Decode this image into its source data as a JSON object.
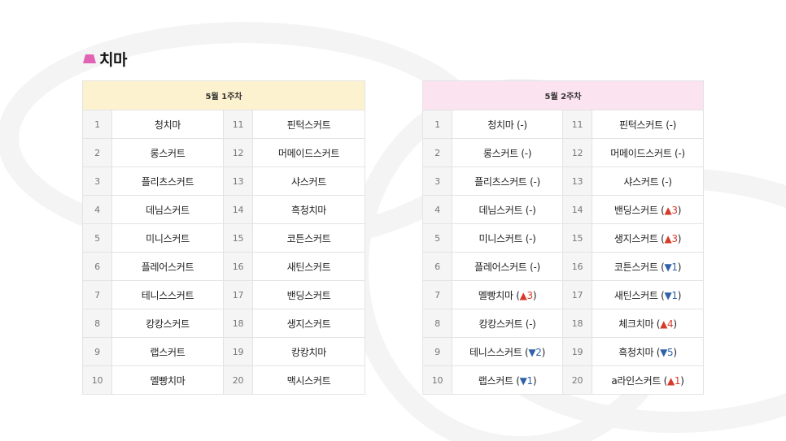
{
  "section": {
    "title": "치마"
  },
  "colors": {
    "header_week1": "#fdf2cf",
    "header_week2": "#fbe3ef",
    "up": "#d63b2a",
    "down": "#2f62a8",
    "icon": "#e063b4"
  },
  "week1": {
    "header": "5월 1주차",
    "rows": [
      {
        "rank_a": "1",
        "item_a": "청치마",
        "rank_b": "11",
        "item_b": "핀턱스커트"
      },
      {
        "rank_a": "2",
        "item_a": "롱스커트",
        "rank_b": "12",
        "item_b": "머메이드스커트"
      },
      {
        "rank_a": "3",
        "item_a": "플리츠스커트",
        "rank_b": "13",
        "item_b": "샤스커트"
      },
      {
        "rank_a": "4",
        "item_a": "데님스커트",
        "rank_b": "14",
        "item_b": "흑청치마"
      },
      {
        "rank_a": "5",
        "item_a": "미니스커트",
        "rank_b": "15",
        "item_b": "코튼스커트"
      },
      {
        "rank_a": "6",
        "item_a": "플레어스커트",
        "rank_b": "16",
        "item_b": "새틴스커트"
      },
      {
        "rank_a": "7",
        "item_a": "테니스스커트",
        "rank_b": "17",
        "item_b": "밴딩스커트"
      },
      {
        "rank_a": "8",
        "item_a": "캉캉스커트",
        "rank_b": "18",
        "item_b": "생지스커트"
      },
      {
        "rank_a": "9",
        "item_a": "랩스커트",
        "rank_b": "19",
        "item_b": "캉캉치마"
      },
      {
        "rank_a": "10",
        "item_a": "멜빵치마",
        "rank_b": "20",
        "item_b": "맥시스커트"
      }
    ]
  },
  "week2": {
    "header": "5월 2주차",
    "rows": [
      {
        "rank_a": "1",
        "item_a": "청치마 (",
        "change_a": "-",
        "dir_a": "none",
        "rank_b": "11",
        "item_b": "핀턱스커트 (",
        "change_b": "-",
        "dir_b": "none"
      },
      {
        "rank_a": "2",
        "item_a": "롱스커트 (",
        "change_a": "-",
        "dir_a": "none",
        "rank_b": "12",
        "item_b": "머메이드스커트 (",
        "change_b": "-",
        "dir_b": "none"
      },
      {
        "rank_a": "3",
        "item_a": "플리츠스커트 (",
        "change_a": "-",
        "dir_a": "none",
        "rank_b": "13",
        "item_b": "샤스커트 (",
        "change_b": "-",
        "dir_b": "none"
      },
      {
        "rank_a": "4",
        "item_a": "데님스커트 (",
        "change_a": "-",
        "dir_a": "none",
        "rank_b": "14",
        "item_b": "밴딩스커트 (",
        "change_b": "▲3",
        "dir_b": "up"
      },
      {
        "rank_a": "5",
        "item_a": "미니스커트 (",
        "change_a": "-",
        "dir_a": "none",
        "rank_b": "15",
        "item_b": "생지스커트 (",
        "change_b": "▲3",
        "dir_b": "up"
      },
      {
        "rank_a": "6",
        "item_a": "플레어스커트 (",
        "change_a": "-",
        "dir_a": "none",
        "rank_b": "16",
        "item_b": "코튼스커트 (",
        "change_b": "▼1",
        "dir_b": "down"
      },
      {
        "rank_a": "7",
        "item_a": "멜빵치마 (",
        "change_a": "▲3",
        "dir_a": "up",
        "rank_b": "17",
        "item_b": "새틴스커트 (",
        "change_b": "▼1",
        "dir_b": "down"
      },
      {
        "rank_a": "8",
        "item_a": "캉캉스커트 (",
        "change_a": "-",
        "dir_a": "none",
        "rank_b": "18",
        "item_b": "체크치마 (",
        "change_b": "▲4",
        "dir_b": "up"
      },
      {
        "rank_a": "9",
        "item_a": "테니스스커트 (",
        "change_a": "▼2",
        "dir_a": "down",
        "rank_b": "19",
        "item_b": "흑청치마 (",
        "change_b": "▼5",
        "dir_b": "down"
      },
      {
        "rank_a": "10",
        "item_a": "랩스커트 (",
        "change_a": "▼1",
        "dir_a": "down",
        "rank_b": "20",
        "item_b": "a라인스커트 (",
        "change_b": "▲1",
        "dir_b": "up"
      }
    ]
  }
}
